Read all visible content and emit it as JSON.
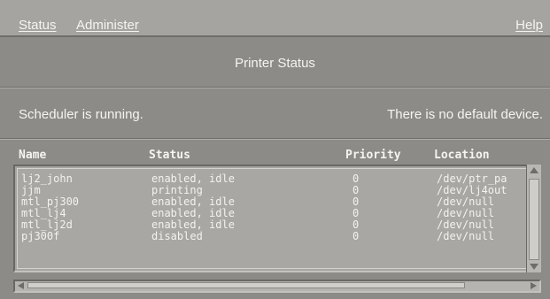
{
  "menubar": {
    "status_label": "Status",
    "administer_label": "Administer",
    "help_label": "Help"
  },
  "title": "Printer Status",
  "status": {
    "scheduler": "Scheduler is running.",
    "default_device": "There is no default device."
  },
  "table": {
    "columns": [
      "Name",
      "Status",
      "Priority",
      "Location"
    ],
    "rows": [
      {
        "name": "lj2_john",
        "status": "enabled, idle",
        "priority": "0",
        "location": "/dev/ptr_pa"
      },
      {
        "name": "jjm",
        "status": "printing",
        "priority": "0",
        "location": "/dev/lj4out"
      },
      {
        "name": "mtl_pj300",
        "status": "enabled, idle",
        "priority": "0",
        "location": "/dev/null"
      },
      {
        "name": "mtl_lj4",
        "status": "enabled, idle",
        "priority": "0",
        "location": "/dev/null"
      },
      {
        "name": "mtl_lj2d",
        "status": "enabled, idle",
        "priority": "0",
        "location": "/dev/null"
      },
      {
        "name": "pj300f",
        "status": "disabled",
        "priority": "0",
        "location": "/dev/null"
      }
    ]
  },
  "colors": {
    "background": "#8d8b87",
    "menubar": "#a6a4a0",
    "text": "#f4f4f0",
    "list_background": "#a9a7a3"
  },
  "icons": [
    "scroll-up-arrow-icon",
    "scroll-down-arrow-icon",
    "scroll-left-arrow-icon",
    "scroll-right-arrow-icon"
  ]
}
